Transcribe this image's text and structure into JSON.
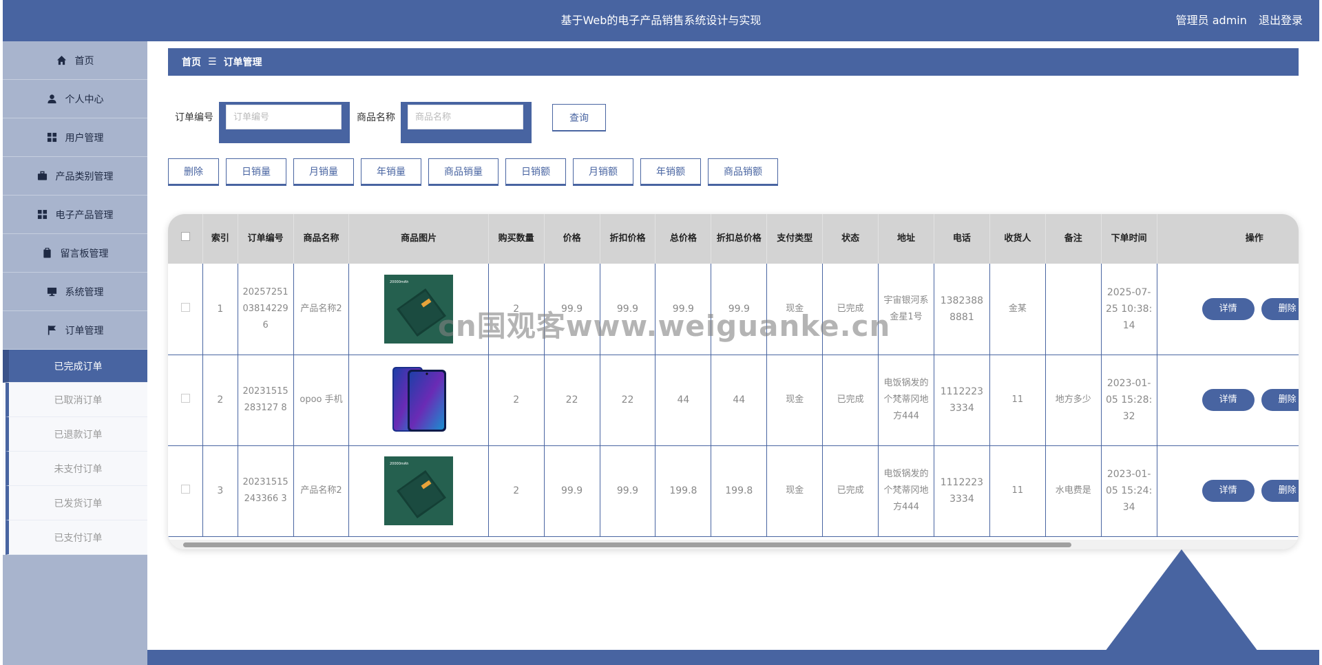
{
  "header": {
    "title": "基于Web的电子产品销售系统设计与实现",
    "user_label": "管理员 admin",
    "logout_label": "退出登录"
  },
  "sidebar": {
    "items": [
      {
        "label": "首页",
        "icon": "home-icon"
      },
      {
        "label": "个人中心",
        "icon": "person-icon"
      },
      {
        "label": "用户管理",
        "icon": "grid-icon"
      },
      {
        "label": "产品类别管理",
        "icon": "briefcase-icon"
      },
      {
        "label": "电子产品管理",
        "icon": "grid-icon"
      },
      {
        "label": "留言板管理",
        "icon": "clipboard-icon"
      },
      {
        "label": "系统管理",
        "icon": "monitor-icon"
      },
      {
        "label": "订单管理",
        "icon": "flag-icon"
      }
    ],
    "subitems": [
      {
        "label": "已完成订单",
        "active": true
      },
      {
        "label": "已取消订单"
      },
      {
        "label": "已退款订单"
      },
      {
        "label": "未支付订单"
      },
      {
        "label": "已发货订单"
      },
      {
        "label": "已支付订单"
      }
    ]
  },
  "breadcrumb": {
    "home": "首页",
    "separator": "☰",
    "current": "订单管理"
  },
  "search": {
    "order_no_label": "订单编号",
    "order_no_placeholder": "订单编号",
    "order_no_value": "",
    "product_name_label": "商品名称",
    "product_name_placeholder": "商品名称",
    "product_name_value": "",
    "query_label": "查询"
  },
  "actions": [
    "删除",
    "日销量",
    "月销量",
    "年销量",
    "商品销量",
    "日销额",
    "月销额",
    "年销额",
    "商品销额"
  ],
  "table": {
    "headers": [
      "索引",
      "订单编号",
      "商品名称",
      "商品图片",
      "购买数量",
      "价格",
      "折扣价格",
      "总价格",
      "折扣总价格",
      "支付类型",
      "状态",
      "地址",
      "电话",
      "收货人",
      "备注",
      "下单时间",
      "操作"
    ],
    "detail_label": "详情",
    "delete_label": "删除",
    "rows": [
      {
        "index": "1",
        "order_no": "20257251038142296",
        "product": "产品名称2",
        "image": "powerbank",
        "qty": "2",
        "price": "99.9",
        "discount_price": "99.9",
        "total": "99.9",
        "discount_total": "99.9",
        "pay_type": "现金",
        "status": "已完成",
        "address": "宇宙银河系金星1号",
        "phone": "13823888881",
        "receiver": "金某",
        "note": "",
        "time": "2025-07-25 10:38:14"
      },
      {
        "index": "2",
        "order_no": "20231515283127 8",
        "product": "opoo 手机",
        "image": "phone",
        "qty": "2",
        "price": "22",
        "discount_price": "22",
        "total": "44",
        "discount_total": "44",
        "pay_type": "现金",
        "status": "已完成",
        "address": "电饭锅发的个梵蒂冈地方444",
        "phone": "11122233334",
        "receiver": "11",
        "note": "地方多少",
        "time": "2023-01-05 15:28:32"
      },
      {
        "index": "3",
        "order_no": "20231515243366 3",
        "product": "产品名称2",
        "image": "powerbank",
        "qty": "2",
        "price": "99.9",
        "discount_price": "99.9",
        "total": "199.8",
        "discount_total": "199.8",
        "pay_type": "现金",
        "status": "已完成",
        "address": "电饭锅发的个梵蒂冈地方444",
        "phone": "11122233334",
        "receiver": "11",
        "note": "水电费是",
        "time": "2023-01-05 15:24:34"
      }
    ]
  },
  "watermark": "cn国观客www.weiguanke.cn",
  "colors": {
    "primary": "#4864a1",
    "sidebar": "#a8b4cd"
  }
}
